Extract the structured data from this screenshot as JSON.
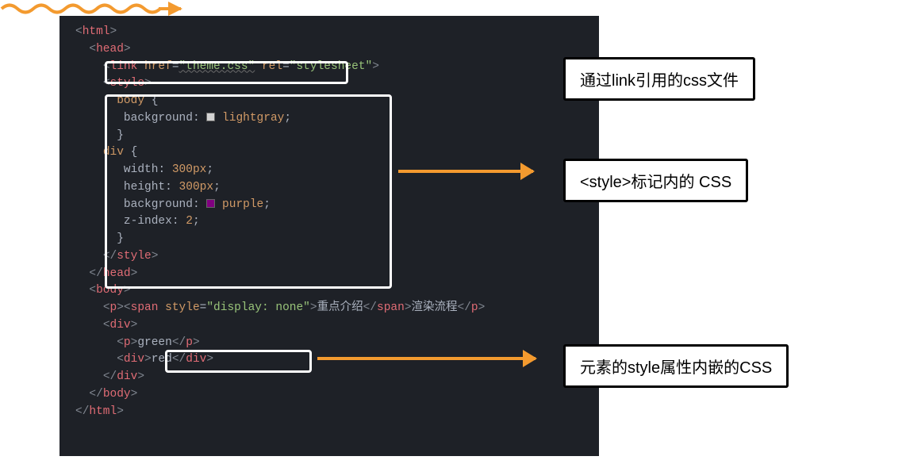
{
  "code": {
    "html_open": "html",
    "head_open": "head",
    "link_tag": "link",
    "link_href_attr": "href",
    "link_href_val": "\"theme.css\"",
    "link_rel_attr": "rel",
    "link_rel_val": "\"stylesheet\"",
    "style_open": "style",
    "body_sel": "body",
    "bg_prop": "background",
    "lightgray_val": "lightgray",
    "div_sel": "div",
    "width_prop": "width",
    "width_val": "300px",
    "height_prop": "height",
    "height_val": "300px",
    "purple_val": "purple",
    "zindex_prop": "z-index",
    "zindex_val": "2",
    "style_close": "style",
    "head_close": "head",
    "body_open": "body",
    "p_tag": "p",
    "span_tag": "span",
    "style_attr": "style",
    "style_attr_val": "\"display: none\"",
    "span_text": "重点介绍",
    "after_span_text": "渲染流程",
    "div_tag": "div",
    "green_text": "green",
    "red_text": "red",
    "body_close": "body",
    "html_close": "html"
  },
  "labels": {
    "link": "通过link引用的css文件",
    "style": "<style>标记内的 CSS",
    "inline": "元素的style属性内嵌的CSS"
  },
  "colors": {
    "arrow": "#f39a2f",
    "editor_bg": "#1e2127"
  }
}
